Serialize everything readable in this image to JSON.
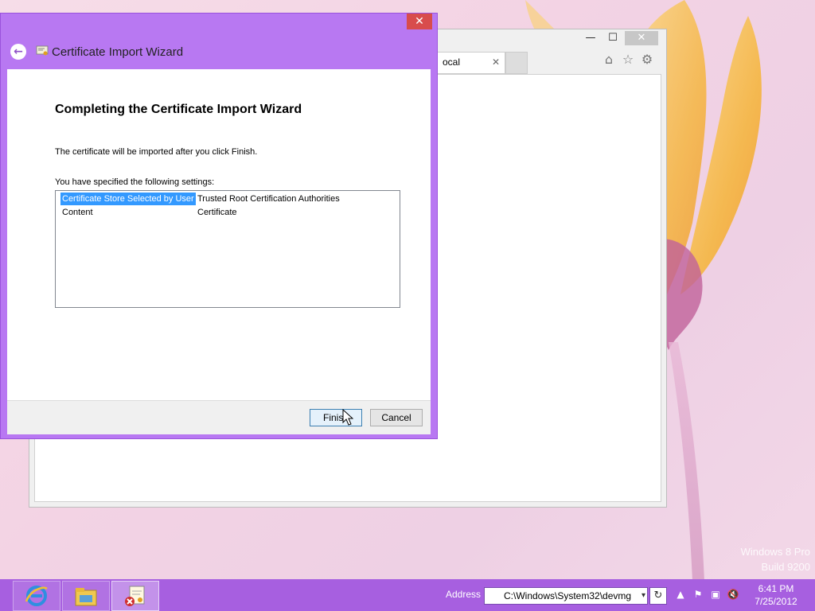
{
  "wizard": {
    "title": "Certificate Import Wizard",
    "heading": "Completing the Certificate Import Wizard",
    "info_text": "The certificate will be imported after you click Finish.",
    "settings_label": "You have specified the following settings:",
    "settings": [
      {
        "key": "Certificate Store Selected by User",
        "value": "Trusted Root Certification Authorities"
      },
      {
        "key": "Content",
        "value": "Certificate"
      }
    ],
    "finish_label": "Finish",
    "cancel_label": "Cancel",
    "close_glyph": "✕"
  },
  "browser": {
    "tab_title": "ocal",
    "tab_close_glyph": "✕",
    "minimize_glyph": "—",
    "maximize_glyph": "☐",
    "close_glyph": "✕",
    "tool_icons": [
      "home-icon",
      "star-icon",
      "gear-icon"
    ]
  },
  "taskbar": {
    "address_label": "Address",
    "address_value": "C:\\Windows\\System32\\devmg",
    "time": "6:41 PM",
    "date": "7/25/2012",
    "pinned": [
      "internet-explorer-icon",
      "file-explorer-icon",
      "certificate-wizard-icon"
    ]
  },
  "watermark": {
    "line1": "Windows 8 Pro",
    "line2": "Build 9200"
  },
  "colors": {
    "wizard_frame": "#b878f2",
    "taskbar": "#a75fe0",
    "selection": "#3399ff"
  }
}
